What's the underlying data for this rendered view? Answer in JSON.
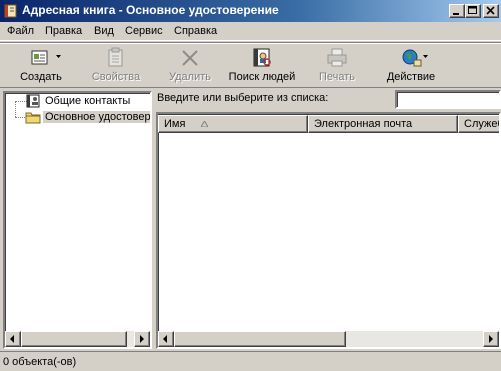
{
  "window": {
    "title": "Адресная книга - Основное удостоверение"
  },
  "menu": [
    "Файл",
    "Правка",
    "Вид",
    "Сервис",
    "Справка"
  ],
  "toolbar": {
    "create": "Создать",
    "properties": "Свойства",
    "delete": "Удалить",
    "find": "Поиск людей",
    "print": "Печать",
    "action": "Действие"
  },
  "tree": {
    "items": [
      {
        "label": "Общие контакты"
      },
      {
        "label": "Основное удостоверение"
      }
    ]
  },
  "search": {
    "label": "Введите или выберите из списка:",
    "value": ""
  },
  "list": {
    "columns": [
      "Имя",
      "Электронная почта",
      "Служебный телефон"
    ]
  },
  "status": {
    "text": "0 объекта(-ов)"
  },
  "icons": {
    "app": "address-book-icon",
    "create": "new-contact-icon",
    "properties": "properties-icon",
    "delete": "delete-icon",
    "find": "find-people-icon",
    "print": "print-icon",
    "action": "action-icon",
    "shared": "shared-contacts-icon",
    "folder": "folder-icon"
  }
}
